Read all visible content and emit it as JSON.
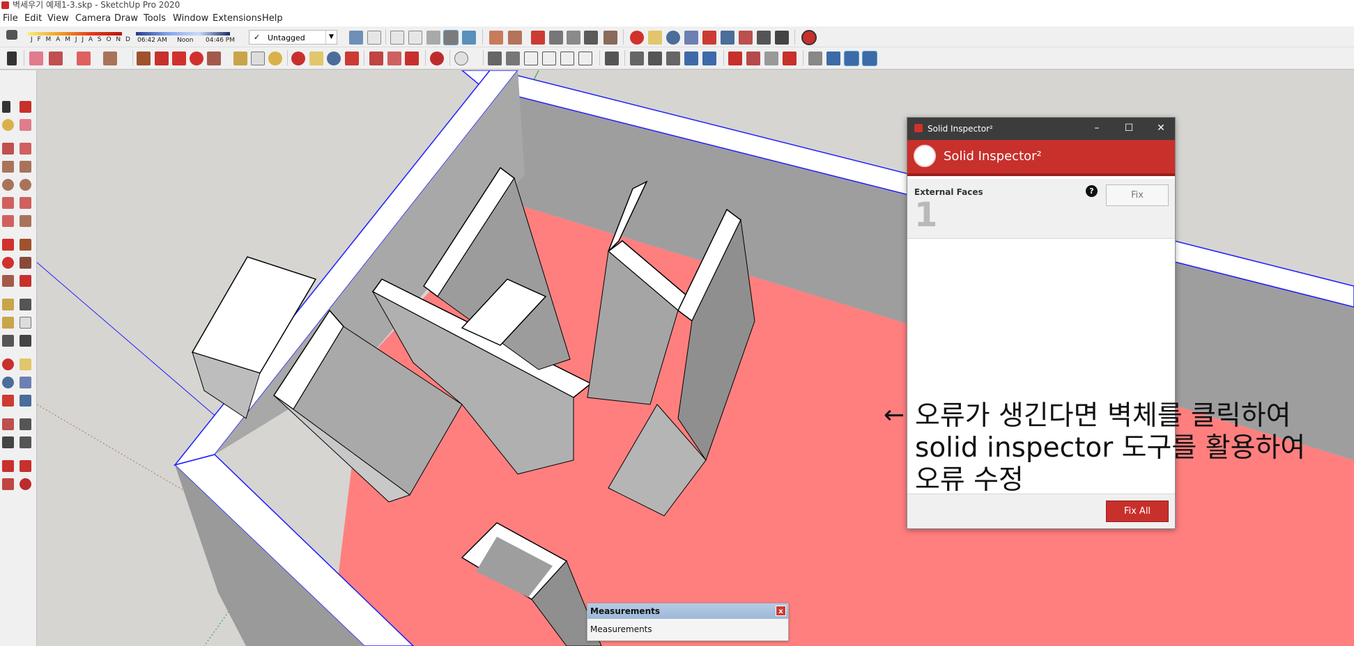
{
  "window": {
    "title": "벽세우기 예제1-3.skp - SketchUp Pro 2020"
  },
  "menu": {
    "items": [
      "File",
      "Edit",
      "View",
      "Camera",
      "Draw",
      "Tools",
      "Window",
      "Extensions",
      "Help"
    ]
  },
  "shadow_settings": {
    "months": "J F M A M J J A S O N D",
    "time_start": "06:42 AM",
    "time_mid": "Noon",
    "time_end": "04:46 PM"
  },
  "tag_dropdown": {
    "check": "✓",
    "value": "Untagged",
    "arrow": "▼"
  },
  "solid_inspector": {
    "window_title": "Solid Inspector²",
    "banner_title": "Solid Inspector²",
    "section_label": "External Faces",
    "count": "1",
    "help": "?",
    "fix_label": "Fix",
    "fix_all_label": "Fix All",
    "controls": {
      "minimize": "–",
      "maximize": "☐",
      "close": "✕"
    }
  },
  "annotation": {
    "arrow": "←",
    "line1": "오류가 생긴다면 벽체를 클릭하여",
    "line2": "solid inspector 도구를 활용하여",
    "line3": "오류 수정"
  },
  "measurements": {
    "title": "Measurements",
    "close": "x",
    "label": "Measurements"
  },
  "colors": {
    "accent_red": "#c8302c",
    "error_face": "#ff7f7f",
    "wall_grey": "#9e9e9e",
    "selection_blue": "#1d1dff"
  }
}
